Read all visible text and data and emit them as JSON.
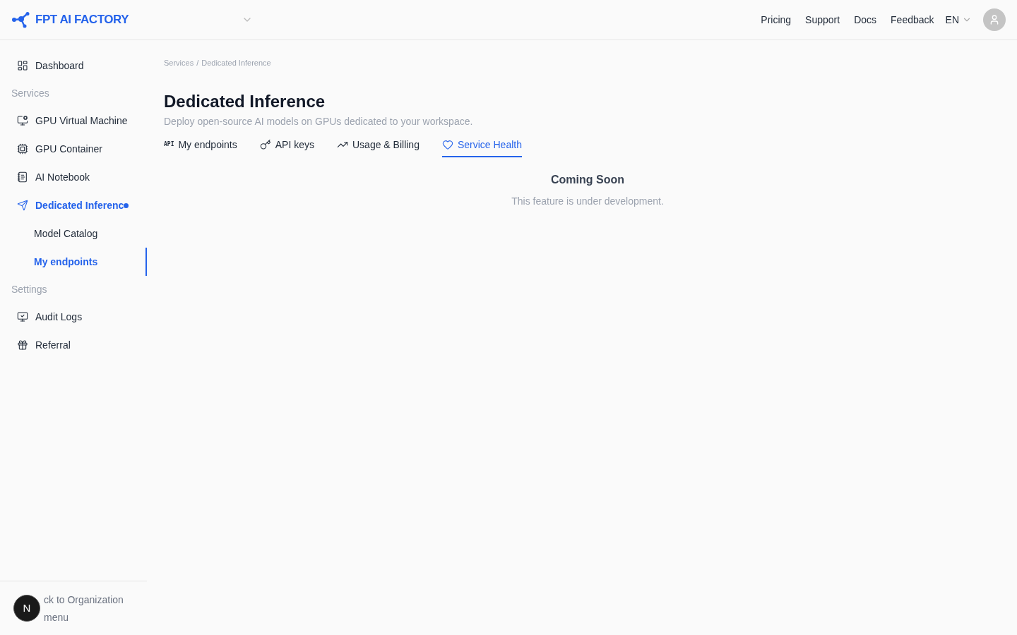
{
  "header": {
    "logo": "FPT AI FACTORY",
    "nav": [
      "Pricing",
      "Support",
      "Docs",
      "Feedback"
    ],
    "language": "EN"
  },
  "sidebar": {
    "items": [
      {
        "kind": "item",
        "label": "Dashboard",
        "selected": false
      },
      {
        "kind": "section",
        "label": "Services"
      },
      {
        "kind": "item",
        "label": "GPU Virtual Machine",
        "selected": false
      },
      {
        "kind": "item",
        "label": "GPU Container",
        "selected": false
      },
      {
        "kind": "item",
        "label": "AI Notebook",
        "selected": false
      },
      {
        "kind": "item",
        "label": "Dedicated Inferenc",
        "selected": true,
        "dot": true
      },
      {
        "kind": "subitem",
        "label": "Model Catalog",
        "selected": false
      },
      {
        "kind": "subitem",
        "label": "My endpoints",
        "selected": true
      },
      {
        "kind": "section",
        "label": "Settings"
      },
      {
        "kind": "item",
        "label": "Audit Logs",
        "selected": false
      },
      {
        "kind": "item",
        "label": "Referral",
        "selected": false
      }
    ],
    "footer": [
      "ck to Organization",
      "menu"
    ],
    "badge": "N"
  },
  "breadcrumb": [
    "Services",
    "/",
    "Dedicated Inference"
  ],
  "page": {
    "title": "Dedicated Inference",
    "subtitle": "Deploy open-source AI models on GPUs dedicated to your workspace."
  },
  "tabs": [
    {
      "label": "My endpoints",
      "icon_text": "API",
      "selected": false
    },
    {
      "label": "API keys",
      "selected": false
    },
    {
      "label": "Usage & Billing",
      "selected": false
    },
    {
      "label": "Service Health",
      "selected": true
    }
  ],
  "empty_state": {
    "title": "Coming Soon",
    "message": "This feature is under development."
  }
}
